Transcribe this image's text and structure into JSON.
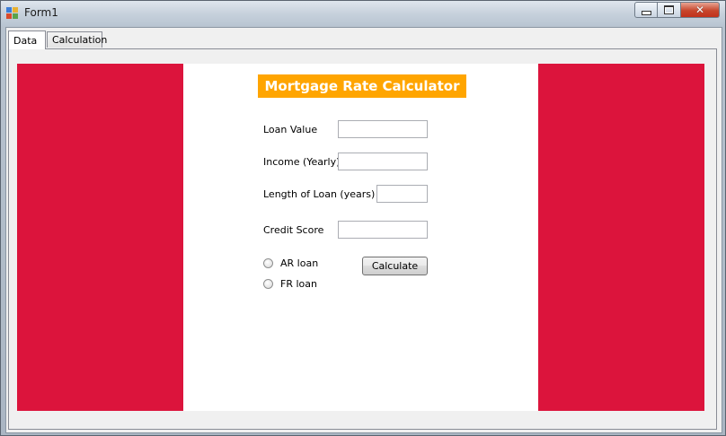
{
  "window": {
    "title": "Form1",
    "icon": "winforms-app-icon",
    "controls": {
      "minimize": "minimize-icon",
      "maximize": "maximize-icon",
      "close": "close-icon"
    }
  },
  "tabs": [
    {
      "label": "Data",
      "selected": true
    },
    {
      "label": "Calculation",
      "selected": false
    }
  ],
  "form": {
    "title": "Mortgage Rate Calculator",
    "fields": {
      "loan_value": {
        "label": "Loan Value",
        "value": ""
      },
      "income": {
        "label": "Income (Yearly)",
        "value": ""
      },
      "loan_length": {
        "label": "Length of Loan (years)",
        "value": ""
      },
      "credit_score": {
        "label": "Credit Score",
        "value": ""
      }
    },
    "radios": [
      {
        "label": "AR loan",
        "checked": false
      },
      {
        "label": "FR loan",
        "checked": false
      }
    ],
    "calculate_label": "Calculate"
  },
  "colors": {
    "side_panels": "#dc143c",
    "title_background": "#ffa500",
    "title_text": "#ffffff",
    "center_panel": "#ffffff"
  }
}
